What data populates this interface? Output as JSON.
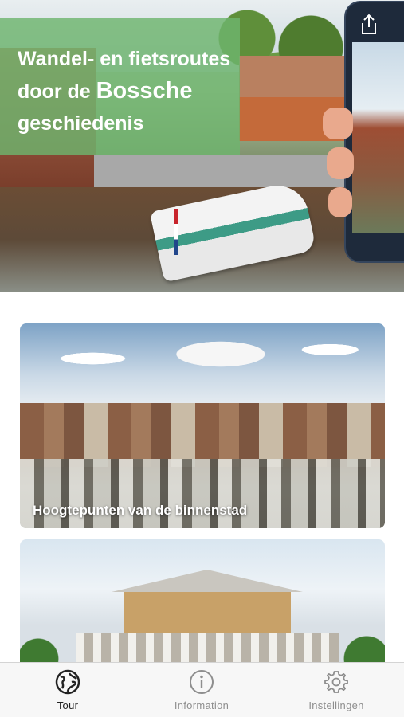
{
  "hero": {
    "banner_line1": "Wandel- en fietsroutes",
    "banner_line2_prefix": "door de ",
    "banner_line2_big": "Bossche",
    "banner_line3": "geschiedenis",
    "share_icon": "share-icon"
  },
  "cards": [
    {
      "title": "Hoogtepunten van de binnenstad"
    },
    {
      "title": ""
    }
  ],
  "tabs": [
    {
      "label": "Tour",
      "icon": "tour-globe-icon",
      "active": true
    },
    {
      "label": "Information",
      "icon": "info-icon",
      "active": false
    },
    {
      "label": "Instellingen",
      "icon": "gear-icon",
      "active": false
    }
  ],
  "colors": {
    "banner_green": "#6eb46e",
    "tab_active": "#222222",
    "tab_inactive": "#8e8e8e"
  }
}
